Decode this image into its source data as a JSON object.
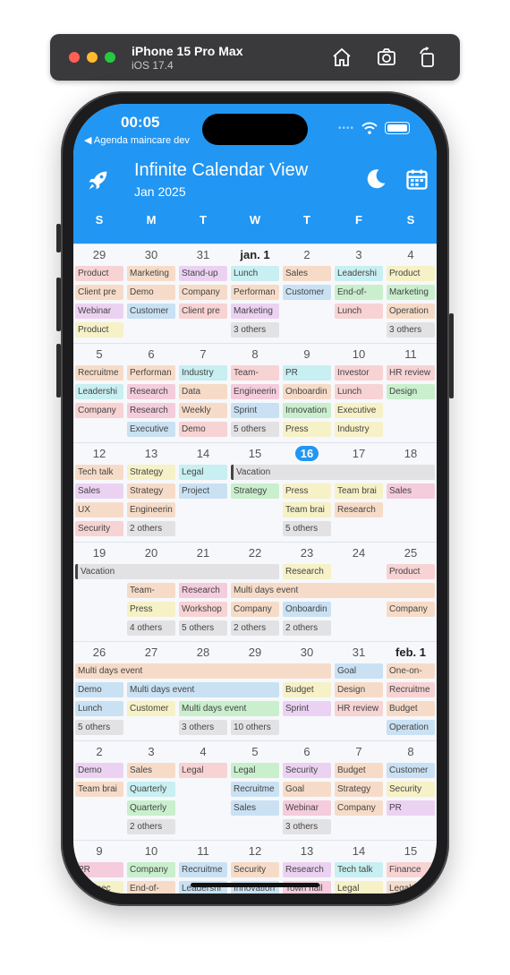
{
  "simulator": {
    "device": "iPhone 15 Pro Max",
    "os": "iOS 17.4",
    "icons": [
      "home-icon",
      "screenshot-icon",
      "rotate-icon"
    ]
  },
  "status_bar": {
    "time": "00:05",
    "back_label": "◀ Agenda maincare dev"
  },
  "app": {
    "title": "Infinite Calendar View",
    "month": "Jan 2025",
    "accent": "#2196f3",
    "left_icon": "rocket-icon",
    "right_icons": [
      "moon-icon",
      "calendar-icon"
    ]
  },
  "weekdays": [
    "S",
    "M",
    "T",
    "W",
    "T",
    "F",
    "S"
  ],
  "colors": {
    "red": "#f7d3d4",
    "orange": "#f6dcc8",
    "yellow": "#f6f1c6",
    "green": "#c9efcd",
    "blue": "#c9e1f3",
    "cyan": "#c8eff1",
    "purple": "#ecd2f2",
    "pink": "#f4ccdc",
    "gray": "#e2e2e4"
  },
  "weeks": [
    {
      "days": [
        {
          "label": "29"
        },
        {
          "label": "30"
        },
        {
          "label": "31"
        },
        {
          "label": "jan. 1",
          "bold": true
        },
        {
          "label": "2"
        },
        {
          "label": "3"
        },
        {
          "label": "4"
        }
      ],
      "events": [
        {
          "text": "Product",
          "col": 0,
          "row": 0,
          "color": "red"
        },
        {
          "text": "Client pre",
          "col": 0,
          "row": 1,
          "color": "orange"
        },
        {
          "text": "Webinar",
          "col": 0,
          "row": 2,
          "color": "purple"
        },
        {
          "text": "Product",
          "col": 0,
          "row": 3,
          "color": "yellow"
        },
        {
          "text": "Marketing",
          "col": 1,
          "row": 0,
          "color": "orange"
        },
        {
          "text": "Demo",
          "col": 1,
          "row": 1,
          "color": "orange"
        },
        {
          "text": "Customer",
          "col": 1,
          "row": 2,
          "color": "blue"
        },
        {
          "text": "Stand-up",
          "col": 2,
          "row": 0,
          "color": "purple"
        },
        {
          "text": "Company",
          "col": 2,
          "row": 1,
          "color": "orange"
        },
        {
          "text": "Client pre",
          "col": 2,
          "row": 2,
          "color": "red"
        },
        {
          "text": "Lunch",
          "col": 3,
          "row": 0,
          "color": "cyan"
        },
        {
          "text": "Performan",
          "col": 3,
          "row": 1,
          "color": "orange"
        },
        {
          "text": "Marketing",
          "col": 3,
          "row": 2,
          "color": "purple"
        },
        {
          "text": "3 others",
          "col": 3,
          "row": 3,
          "color": "gray"
        },
        {
          "text": "Sales",
          "col": 4,
          "row": 0,
          "color": "orange"
        },
        {
          "text": "Customer",
          "col": 4,
          "row": 1,
          "color": "blue"
        },
        {
          "text": "Leadershi",
          "col": 5,
          "row": 0,
          "color": "cyan"
        },
        {
          "text": "End-of-",
          "col": 5,
          "row": 1,
          "color": "green"
        },
        {
          "text": "Lunch",
          "col": 5,
          "row": 2,
          "color": "red"
        },
        {
          "text": "Product",
          "col": 6,
          "row": 0,
          "color": "yellow"
        },
        {
          "text": "Marketing",
          "col": 6,
          "row": 1,
          "color": "green"
        },
        {
          "text": "Operation",
          "col": 6,
          "row": 2,
          "color": "orange"
        },
        {
          "text": "3 others",
          "col": 6,
          "row": 3,
          "color": "gray"
        }
      ]
    },
    {
      "days": [
        {
          "label": "5"
        },
        {
          "label": "6"
        },
        {
          "label": "7"
        },
        {
          "label": "8"
        },
        {
          "label": "9"
        },
        {
          "label": "10"
        },
        {
          "label": "11"
        }
      ],
      "events": [
        {
          "text": "Recruitme",
          "col": 0,
          "row": 0,
          "color": "orange"
        },
        {
          "text": "Leadershi",
          "col": 0,
          "row": 1,
          "color": "cyan"
        },
        {
          "text": "Company",
          "col": 0,
          "row": 2,
          "color": "red"
        },
        {
          "text": "Performan",
          "col": 1,
          "row": 0,
          "color": "orange"
        },
        {
          "text": "Research",
          "col": 1,
          "row": 1,
          "color": "pink"
        },
        {
          "text": "Research",
          "col": 1,
          "row": 2,
          "color": "pink"
        },
        {
          "text": "Executive",
          "col": 1,
          "row": 3,
          "color": "blue"
        },
        {
          "text": "Industry",
          "col": 2,
          "row": 0,
          "color": "cyan"
        },
        {
          "text": "Data",
          "col": 2,
          "row": 1,
          "color": "orange"
        },
        {
          "text": "Weekly",
          "col": 2,
          "row": 2,
          "color": "orange"
        },
        {
          "text": "Demo",
          "col": 2,
          "row": 3,
          "color": "red"
        },
        {
          "text": "Team-",
          "col": 3,
          "row": 0,
          "color": "red"
        },
        {
          "text": "Engineerin",
          "col": 3,
          "row": 1,
          "color": "pink"
        },
        {
          "text": "Sprint",
          "col": 3,
          "row": 2,
          "color": "blue"
        },
        {
          "text": "5 others",
          "col": 3,
          "row": 3,
          "color": "gray"
        },
        {
          "text": "PR",
          "col": 4,
          "row": 0,
          "color": "cyan"
        },
        {
          "text": "Onboardin",
          "col": 4,
          "row": 1,
          "color": "orange"
        },
        {
          "text": "Innovation",
          "col": 4,
          "row": 2,
          "color": "green"
        },
        {
          "text": "Press",
          "col": 4,
          "row": 3,
          "color": "yellow"
        },
        {
          "text": "Investor",
          "col": 5,
          "row": 0,
          "color": "red"
        },
        {
          "text": "Lunch",
          "col": 5,
          "row": 1,
          "color": "red"
        },
        {
          "text": "Executive",
          "col": 5,
          "row": 2,
          "color": "yellow"
        },
        {
          "text": "Industry",
          "col": 5,
          "row": 3,
          "color": "yellow"
        },
        {
          "text": "HR review",
          "col": 6,
          "row": 0,
          "color": "red"
        },
        {
          "text": "Design",
          "col": 6,
          "row": 1,
          "color": "green"
        }
      ]
    },
    {
      "days": [
        {
          "label": "12"
        },
        {
          "label": "13"
        },
        {
          "label": "14"
        },
        {
          "label": "15"
        },
        {
          "label": "16",
          "today": true
        },
        {
          "label": "17"
        },
        {
          "label": "18"
        }
      ],
      "events": [
        {
          "text": "Tech talk",
          "col": 0,
          "row": 0,
          "color": "orange"
        },
        {
          "text": "Sales",
          "col": 0,
          "row": 1,
          "color": "purple"
        },
        {
          "text": "UX",
          "col": 0,
          "row": 2,
          "color": "orange"
        },
        {
          "text": "Security",
          "col": 0,
          "row": 3,
          "color": "red"
        },
        {
          "text": "Strategy",
          "col": 1,
          "row": 0,
          "color": "yellow"
        },
        {
          "text": "Strategy",
          "col": 1,
          "row": 1,
          "color": "orange"
        },
        {
          "text": "Engineerin",
          "col": 1,
          "row": 2,
          "color": "orange"
        },
        {
          "text": "2 others",
          "col": 1,
          "row": 3,
          "color": "gray"
        },
        {
          "text": "Legal",
          "col": 2,
          "row": 0,
          "color": "cyan"
        },
        {
          "text": "Project",
          "col": 2,
          "row": 1,
          "color": "blue"
        },
        {
          "text": "Vacation",
          "col": 3,
          "span": 4,
          "row": 0,
          "color": "gray",
          "multi": true
        },
        {
          "text": "Strategy",
          "col": 3,
          "row": 1,
          "color": "green"
        },
        {
          "text": "Press",
          "col": 4,
          "row": 1,
          "color": "yellow"
        },
        {
          "text": "Team brai",
          "col": 4,
          "row": 2,
          "color": "yellow"
        },
        {
          "text": "5 others",
          "col": 4,
          "row": 3,
          "color": "gray"
        },
        {
          "text": "Team brai",
          "col": 5,
          "row": 1,
          "color": "yellow"
        },
        {
          "text": "Research",
          "col": 5,
          "row": 2,
          "color": "orange"
        },
        {
          "text": "Sales",
          "col": 6,
          "row": 1,
          "color": "pink"
        }
      ]
    },
    {
      "days": [
        {
          "label": "19"
        },
        {
          "label": "20"
        },
        {
          "label": "21"
        },
        {
          "label": "22"
        },
        {
          "label": "23"
        },
        {
          "label": "24"
        },
        {
          "label": "25"
        }
      ],
      "events": [
        {
          "text": "Vacation",
          "col": 0,
          "span": 4,
          "row": 0,
          "color": "gray",
          "multi": true
        },
        {
          "text": "Research",
          "col": 4,
          "row": 0,
          "color": "yellow"
        },
        {
          "text": "Product",
          "col": 6,
          "row": 0,
          "color": "red"
        },
        {
          "text": "Team-",
          "col": 1,
          "row": 1,
          "color": "orange"
        },
        {
          "text": "Press",
          "col": 1,
          "row": 2,
          "color": "yellow"
        },
        {
          "text": "4 others",
          "col": 1,
          "row": 3,
          "color": "gray"
        },
        {
          "text": "Research",
          "col": 2,
          "row": 1,
          "color": "pink"
        },
        {
          "text": "Workshop",
          "col": 2,
          "row": 2,
          "color": "red"
        },
        {
          "text": "5 others",
          "col": 2,
          "row": 3,
          "color": "gray"
        },
        {
          "text": "Multi days event",
          "col": 3,
          "span": 4,
          "row": 1,
          "color": "orange"
        },
        {
          "text": "Company",
          "col": 3,
          "row": 2,
          "color": "orange"
        },
        {
          "text": "2 others",
          "col": 3,
          "row": 3,
          "color": "gray"
        },
        {
          "text": "Onboardin",
          "col": 4,
          "row": 2,
          "color": "blue"
        },
        {
          "text": "2 others",
          "col": 4,
          "row": 3,
          "color": "gray"
        },
        {
          "text": "Company",
          "col": 6,
          "row": 2,
          "color": "orange"
        }
      ]
    },
    {
      "days": [
        {
          "label": "26"
        },
        {
          "label": "27"
        },
        {
          "label": "28"
        },
        {
          "label": "29"
        },
        {
          "label": "30"
        },
        {
          "label": "31"
        },
        {
          "label": "feb. 1",
          "bold": true
        }
      ],
      "events": [
        {
          "text": "Multi days event",
          "col": 0,
          "span": 5,
          "row": 0,
          "color": "orange"
        },
        {
          "text": "Goal",
          "col": 5,
          "row": 0,
          "color": "blue"
        },
        {
          "text": "One-on-",
          "col": 6,
          "row": 0,
          "color": "orange"
        },
        {
          "text": "Demo",
          "col": 0,
          "row": 1,
          "color": "blue"
        },
        {
          "text": "Lunch",
          "col": 0,
          "row": 2,
          "color": "blue"
        },
        {
          "text": "5 others",
          "col": 0,
          "row": 3,
          "color": "gray"
        },
        {
          "text": "Multi days event",
          "col": 1,
          "span": 3,
          "row": 1,
          "color": "blue"
        },
        {
          "text": "Customer",
          "col": 1,
          "row": 2,
          "color": "yellow"
        },
        {
          "text": "Multi days event",
          "col": 2,
          "span": 2,
          "row": 2,
          "color": "green"
        },
        {
          "text": "3 others",
          "col": 2,
          "row": 3,
          "color": "gray"
        },
        {
          "text": "10 others",
          "col": 3,
          "row": 3,
          "color": "gray"
        },
        {
          "text": "Budget",
          "col": 4,
          "row": 1,
          "color": "yellow"
        },
        {
          "text": "Sprint",
          "col": 4,
          "row": 2,
          "color": "purple"
        },
        {
          "text": "Design",
          "col": 5,
          "row": 1,
          "color": "orange"
        },
        {
          "text": "HR review",
          "col": 5,
          "row": 2,
          "color": "red"
        },
        {
          "text": "Recruitme",
          "col": 6,
          "row": 1,
          "color": "red"
        },
        {
          "text": "Budget",
          "col": 6,
          "row": 2,
          "color": "orange"
        },
        {
          "text": "Operation",
          "col": 6,
          "row": 3,
          "color": "blue"
        }
      ]
    },
    {
      "days": [
        {
          "label": "2"
        },
        {
          "label": "3"
        },
        {
          "label": "4"
        },
        {
          "label": "5"
        },
        {
          "label": "6"
        },
        {
          "label": "7"
        },
        {
          "label": "8"
        }
      ],
      "events": [
        {
          "text": "Demo",
          "col": 0,
          "row": 0,
          "color": "purple"
        },
        {
          "text": "Team brai",
          "col": 0,
          "row": 1,
          "color": "orange"
        },
        {
          "text": "Sales",
          "col": 1,
          "row": 0,
          "color": "orange"
        },
        {
          "text": "Quarterly",
          "col": 1,
          "row": 1,
          "color": "cyan"
        },
        {
          "text": "Quarterly",
          "col": 1,
          "row": 2,
          "color": "green"
        },
        {
          "text": "2 others",
          "col": 1,
          "row": 3,
          "color": "gray"
        },
        {
          "text": "Legal",
          "col": 2,
          "row": 0,
          "color": "red"
        },
        {
          "text": "Legal",
          "col": 3,
          "row": 0,
          "color": "green"
        },
        {
          "text": "Recruitme",
          "col": 3,
          "row": 1,
          "color": "blue"
        },
        {
          "text": "Sales",
          "col": 3,
          "row": 2,
          "color": "blue"
        },
        {
          "text": "Security",
          "col": 4,
          "row": 0,
          "color": "purple"
        },
        {
          "text": "Goal",
          "col": 4,
          "row": 1,
          "color": "orange"
        },
        {
          "text": "Webinar",
          "col": 4,
          "row": 2,
          "color": "pink"
        },
        {
          "text": "3 others",
          "col": 4,
          "row": 3,
          "color": "gray"
        },
        {
          "text": "Budget",
          "col": 5,
          "row": 0,
          "color": "orange"
        },
        {
          "text": "Strategy",
          "col": 5,
          "row": 1,
          "color": "orange"
        },
        {
          "text": "Company",
          "col": 5,
          "row": 2,
          "color": "orange"
        },
        {
          "text": "Customer",
          "col": 6,
          "row": 0,
          "color": "blue"
        },
        {
          "text": "Security",
          "col": 6,
          "row": 1,
          "color": "yellow"
        },
        {
          "text": "PR",
          "col": 6,
          "row": 2,
          "color": "purple"
        }
      ]
    },
    {
      "days": [
        {
          "label": "9"
        },
        {
          "label": "10"
        },
        {
          "label": "11"
        },
        {
          "label": "12"
        },
        {
          "label": "13"
        },
        {
          "label": "14"
        },
        {
          "label": "15"
        }
      ],
      "events": [
        {
          "text": "PR",
          "col": 0,
          "row": 0,
          "color": "pink"
        },
        {
          "text": "Prospec",
          "col": 0,
          "row": 1,
          "color": "yellow"
        },
        {
          "text": "Company",
          "col": 1,
          "row": 0,
          "color": "green"
        },
        {
          "text": "End-of-",
          "col": 1,
          "row": 1,
          "color": "orange"
        },
        {
          "text": "Recruitme",
          "col": 2,
          "row": 0,
          "color": "blue"
        },
        {
          "text": "Leadershi",
          "col": 2,
          "row": 1,
          "color": "blue"
        },
        {
          "text": "Security",
          "col": 3,
          "row": 0,
          "color": "orange"
        },
        {
          "text": "Innovation",
          "col": 3,
          "row": 1,
          "color": "blue"
        },
        {
          "text": "Research",
          "col": 4,
          "row": 0,
          "color": "purple"
        },
        {
          "text": "Town hall",
          "col": 4,
          "row": 1,
          "color": "pink"
        },
        {
          "text": "Tech talk",
          "col": 5,
          "row": 0,
          "color": "cyan"
        },
        {
          "text": "Legal",
          "col": 5,
          "row": 1,
          "color": "yellow"
        },
        {
          "text": "Finance",
          "col": 6,
          "row": 0,
          "color": "red"
        },
        {
          "text": "Legal",
          "col": 6,
          "row": 1,
          "color": "orange"
        }
      ]
    }
  ]
}
